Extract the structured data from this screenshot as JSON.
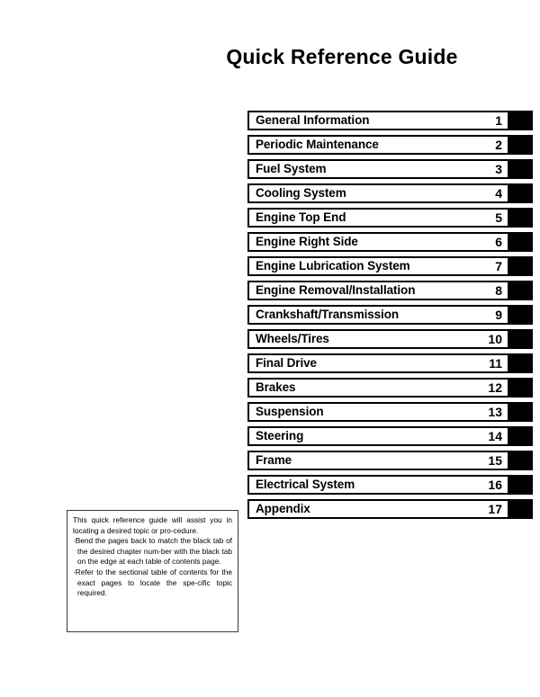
{
  "document": {
    "title": "Quick Reference Guide"
  },
  "chapter_index": {
    "rows": [
      {
        "title": "General Information",
        "number": "1"
      },
      {
        "title": "Periodic Maintenance",
        "number": "2"
      },
      {
        "title": "Fuel System",
        "number": "3"
      },
      {
        "title": "Cooling System",
        "number": "4"
      },
      {
        "title": "Engine Top End",
        "number": "5"
      },
      {
        "title": "Engine Right Side",
        "number": "6"
      },
      {
        "title": "Engine Lubrication System",
        "number": "7"
      },
      {
        "title": "Engine Removal/Installation",
        "number": "8"
      },
      {
        "title": "Crankshaft/Transmission",
        "number": "9"
      },
      {
        "title": "Wheels/Tires",
        "number": "10"
      },
      {
        "title": "Final Drive",
        "number": "11"
      },
      {
        "title": "Brakes",
        "number": "12"
      },
      {
        "title": "Suspension",
        "number": "13"
      },
      {
        "title": "Steering",
        "number": "14"
      },
      {
        "title": "Frame",
        "number": "15"
      },
      {
        "title": "Electrical System",
        "number": "16"
      },
      {
        "title": "Appendix",
        "number": "17"
      }
    ],
    "tab_color": "#000000"
  },
  "note": {
    "intro": "This quick reference guide will assist you in locating a desired topic or pro-cedure.",
    "bullet_marker": "·",
    "bullets": [
      "Bend the pages back to match the black tab of the desired chapter num-ber with the black tab on the edge at each table of contents page.",
      "Refer to the sectional table of contents for the exact pages to locate the spe-cific topic required."
    ]
  }
}
